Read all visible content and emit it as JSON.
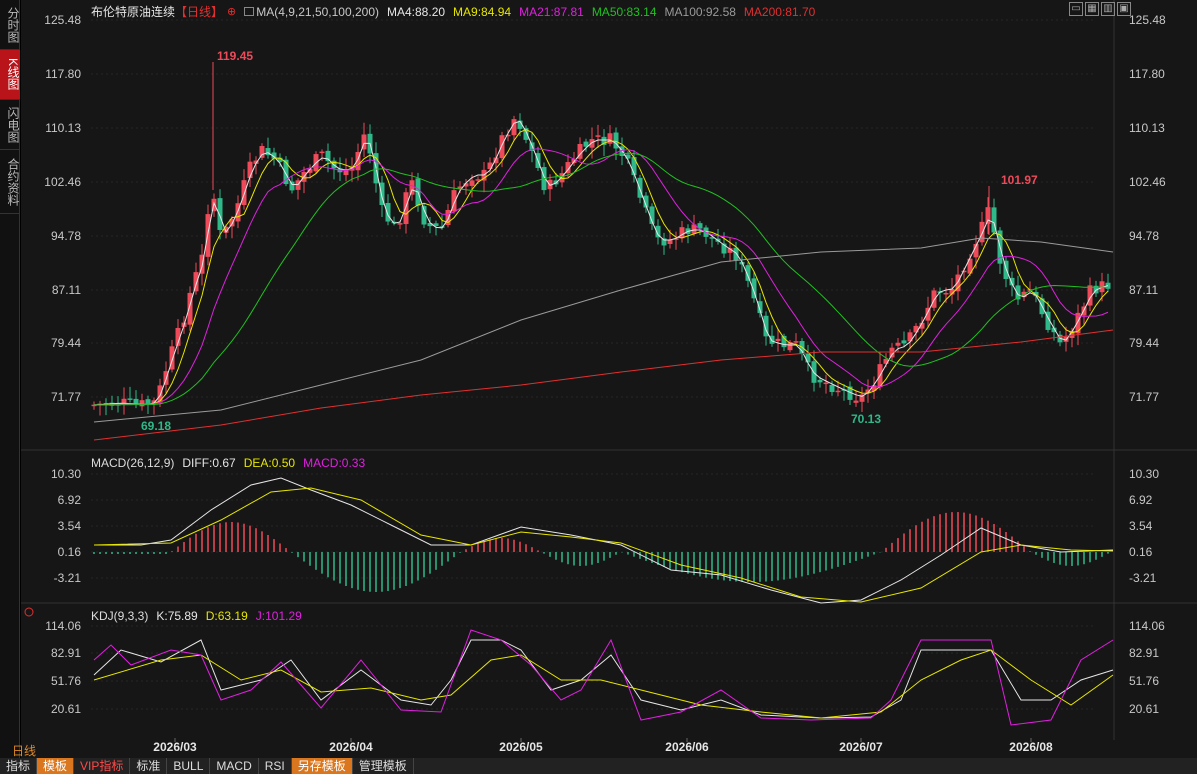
{
  "side_tabs": [
    {
      "label": "分时图",
      "active": false
    },
    {
      "label": "K线图",
      "active": true
    },
    {
      "label": "闪电图",
      "active": false
    },
    {
      "label": "合约资料",
      "active": false
    }
  ],
  "header": {
    "title": "布伦特原油连续",
    "period_tag": "【日线】",
    "settings_icon": "target-icon",
    "ma_params": "MA(4,9,21,50,100,200)",
    "ma_values": [
      {
        "label": "MA4:88.20",
        "color": "#e6e6e6"
      },
      {
        "label": "MA9:84.94",
        "color": "#e6e600"
      },
      {
        "label": "MA21:87.81",
        "color": "#e020e0"
      },
      {
        "label": "MA50:83.14",
        "color": "#20c020"
      },
      {
        "label": "MA100:92.58",
        "color": "#9a9a9a"
      },
      {
        "label": "MA200:81.70",
        "color": "#e03030"
      }
    ]
  },
  "window_controls": [
    "▭",
    "▦",
    "▥",
    "▣"
  ],
  "price_axis": [
    "125.48",
    "117.80",
    "110.13",
    "102.46",
    "94.78",
    "87.11",
    "79.44",
    "71.77"
  ],
  "price_annotations": {
    "high1": "119.45",
    "low1": "69.18",
    "high2": "101.97",
    "low2": "70.13"
  },
  "macd": {
    "title": "MACD(26,12,9)",
    "diff": "DIFF:0.67",
    "dea": "DEA:0.50",
    "macd": "MACD:0.33",
    "axis": [
      "10.30",
      "6.92",
      "3.54",
      "0.16",
      "-3.21"
    ]
  },
  "kdj": {
    "title": "KDJ(9,3,3)",
    "k": "K:75.89",
    "d": "D:63.19",
    "j": "J:101.29",
    "axis": [
      "114.06",
      "82.91",
      "51.76",
      "20.61"
    ]
  },
  "date_axis": [
    "2026/03",
    "2026/04",
    "2026/05",
    "2026/06",
    "2026/07",
    "2026/08"
  ],
  "period_label": "日线",
  "bottom_bar": [
    {
      "label": "指标",
      "style": "normal"
    },
    {
      "label": "模板",
      "style": "orange"
    },
    {
      "label": "VIP指标",
      "style": "red"
    },
    {
      "label": "标准",
      "style": "normal"
    },
    {
      "label": "BULL",
      "style": "normal"
    },
    {
      "label": "MACD",
      "style": "normal"
    },
    {
      "label": "RSI",
      "style": "normal"
    },
    {
      "label": "另存模板",
      "style": "orange"
    },
    {
      "label": "管理模板",
      "style": "normal"
    }
  ],
  "colors": {
    "up": "#ef4a5a",
    "down": "#2fb88a",
    "annotation_up": "#ef4a5a",
    "annotation_down": "#2fb88a",
    "label": "#c8c8c8"
  }
}
